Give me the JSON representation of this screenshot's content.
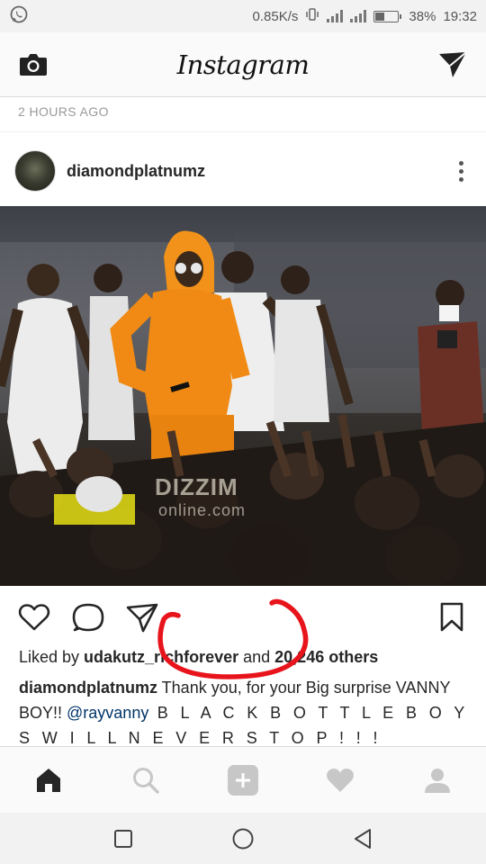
{
  "status_bar": {
    "network_speed": "0.85K/s",
    "battery": "38%",
    "battery_level": 0.38,
    "time": "19:32",
    "icons": [
      "whatsapp-icon",
      "vibrate-icon",
      "signal-icon",
      "h-plus-signal-icon",
      "battery-icon"
    ]
  },
  "header": {
    "logo": "Instagram",
    "left_icon": "camera-icon",
    "right_icon": "direct-message-icon"
  },
  "feed": {
    "time_ago": "2 HOURS AGO"
  },
  "post": {
    "username": "diamondplatnumz",
    "photo": {
      "watermark": "DIZZIM",
      "watermark_sub": "online.com"
    },
    "likes": {
      "prefix": "Liked by ",
      "user": "udakutz_richforever",
      "middle": " and ",
      "count": "20,246 others"
    },
    "caption": {
      "username": "diamondplatnumz",
      "text1": " Thank you, for your Big surprise VANNY BOY!! ",
      "mention": "@rayvanny",
      "text2": " B L A C K B O T T L E B O Y S W I L L N E V E R S T O P ! ! !"
    },
    "annotation_color": "#e8141c"
  },
  "bottom_nav": {
    "items": [
      "home-icon",
      "search-icon",
      "add-post-icon",
      "activity-heart-icon",
      "profile-icon"
    ]
  },
  "system_nav": {
    "items": [
      "recents-icon",
      "home-circle-icon",
      "back-icon"
    ]
  }
}
